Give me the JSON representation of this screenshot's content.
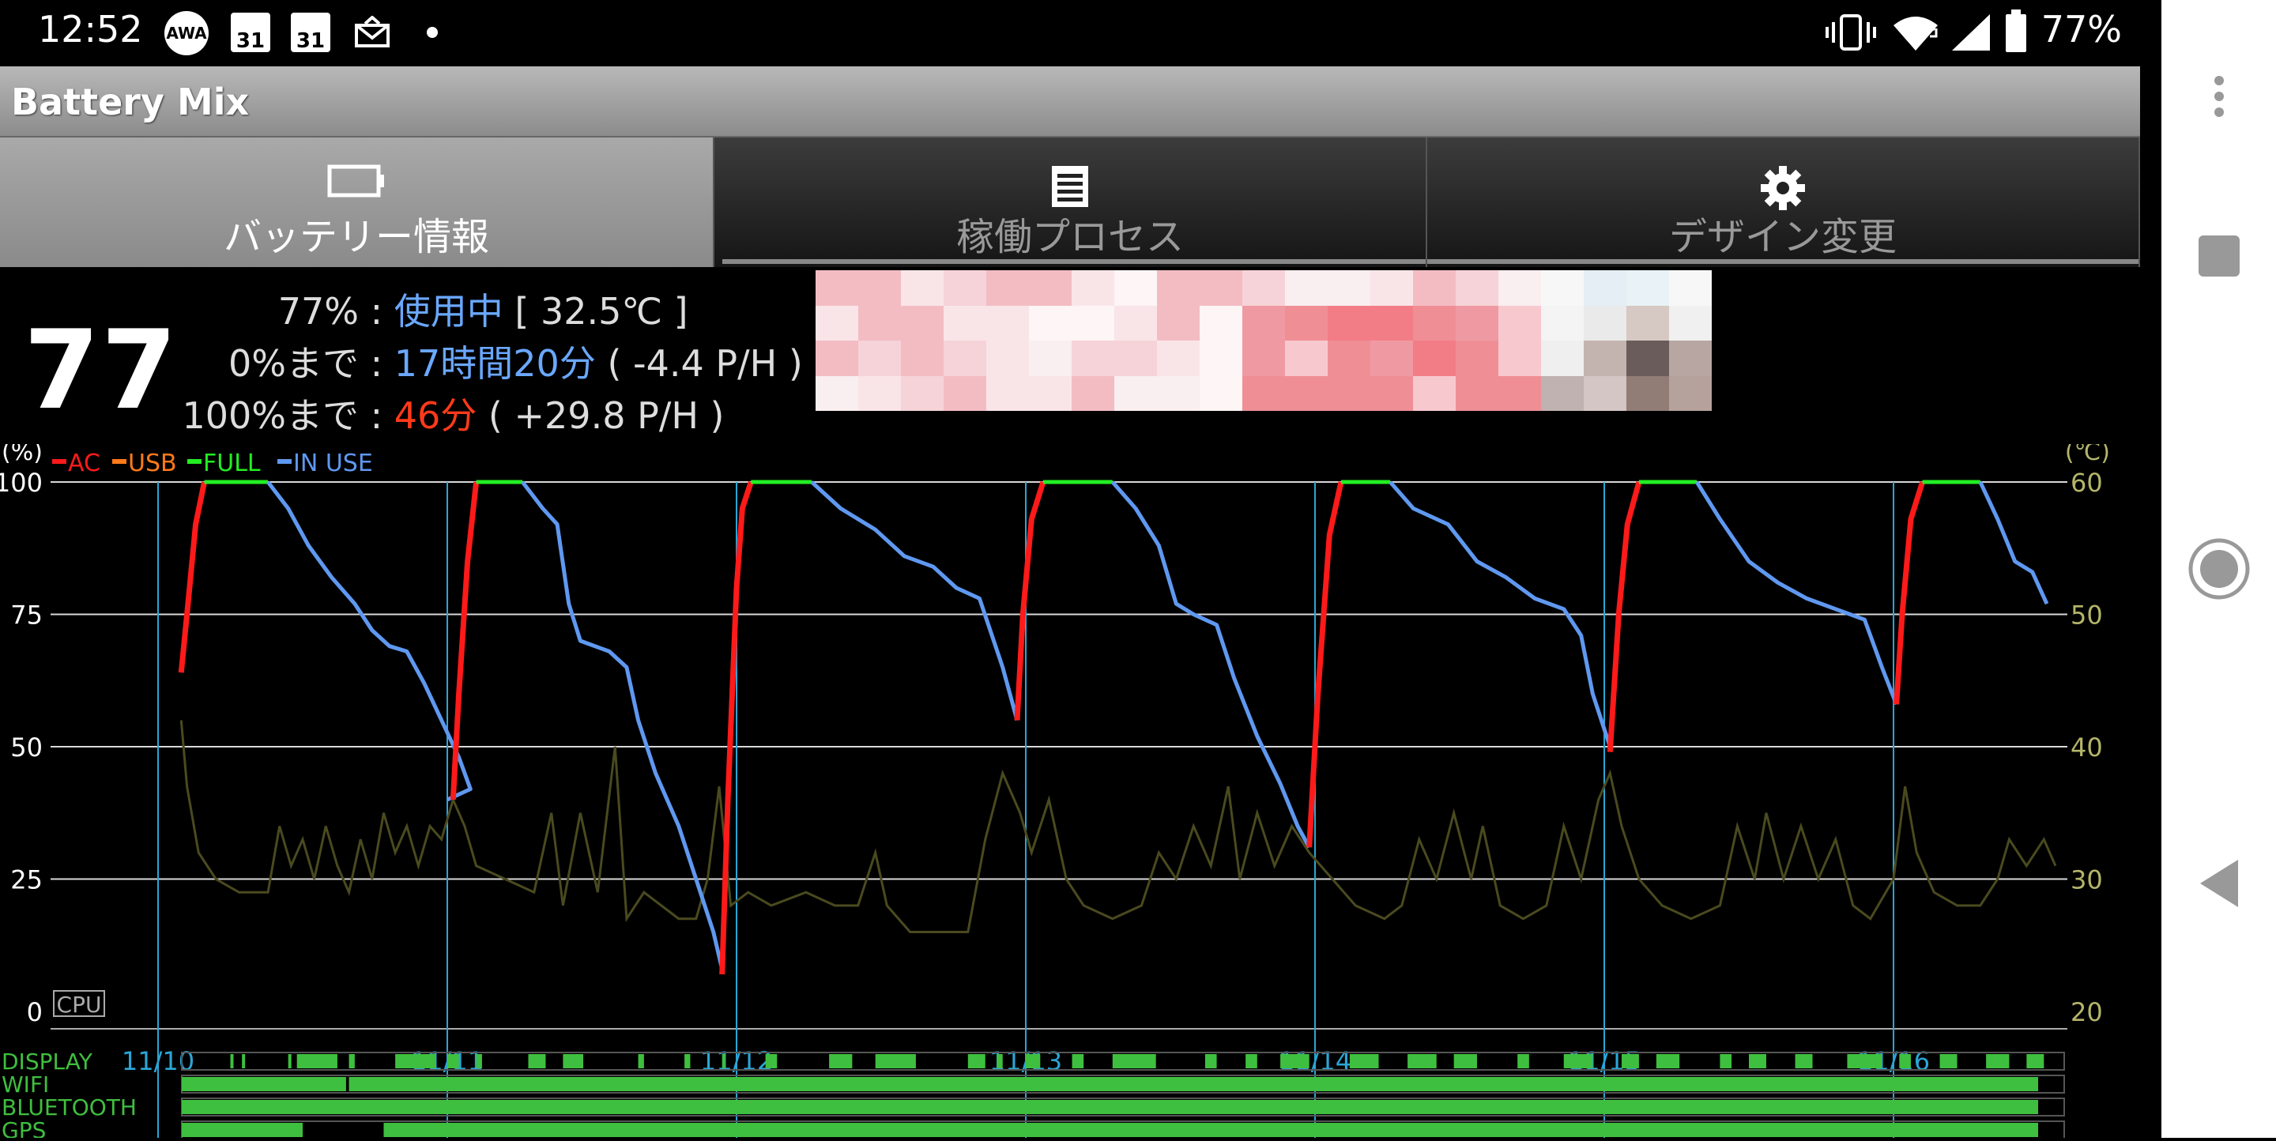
{
  "status_bar": {
    "time": "12:52",
    "icons": [
      "awa-icon",
      "calendar-icon",
      "calendar-icon",
      "mail-icon",
      "dot-icon"
    ],
    "calendar_day": "31",
    "awa_label": "AWA",
    "battery_percent": "77%",
    "right_icons": [
      "vibrate-icon",
      "wifi-icon",
      "signal-icon",
      "battery-icon"
    ]
  },
  "app": {
    "title": "Battery Mix"
  },
  "tabs": [
    {
      "label": "バッテリー情報",
      "icon": "battery-outline-icon",
      "selected": true
    },
    {
      "label": "稼働プロセス",
      "icon": "list-icon",
      "selected": false
    },
    {
      "label": "デザイン変更",
      "icon": "gear-icon",
      "selected": false
    }
  ],
  "battery_info": {
    "level": "77",
    "row1_label": "77%",
    "row1_sep": ":",
    "row1_value": "使用中",
    "row1_extra": "[ 32.5℃ ]",
    "row2_label": "0%まで",
    "row2_sep": ":",
    "row2_value": "17時間20分",
    "row2_extra": "( -4.4 P/H )",
    "row3_label": "100%まで",
    "row3_sep": ":",
    "row3_value": "46分",
    "row3_extra": "( +29.8 P/H )"
  },
  "colors": {
    "ac": "#ff1a1a",
    "usb": "#ff7a1a",
    "full": "#22ee22",
    "in_use": "#5f98f0",
    "temp": "#4a4a1f",
    "day_line": "#2aa6d6",
    "grid": "#d8d8d8",
    "bars": "#3fbf3f"
  },
  "chart_data": {
    "type": "line",
    "left_unit": "(%)",
    "right_unit": "(℃)",
    "legend": [
      {
        "name": "AC",
        "color": "#ff1a1a"
      },
      {
        "name": "USB",
        "color": "#ff7a1a"
      },
      {
        "name": "FULL",
        "color": "#22ee22"
      },
      {
        "name": "IN USE",
        "color": "#5f98f0"
      }
    ],
    "cpu_label": "CPU",
    "yticks_left": [
      "100",
      "75",
      "50",
      "25",
      "0"
    ],
    "yticks_right": [
      "60",
      "50",
      "40",
      "30",
      "20"
    ],
    "ylim_left": [
      0,
      100
    ],
    "ylim_right": [
      20,
      60
    ],
    "x_labels": [
      "11/10",
      "11/11",
      "11/12",
      "11/13",
      "11/14",
      "11/15",
      "11/16"
    ],
    "x_range_days": [
      0,
      6.6
    ],
    "battery_series": [
      [
        0.08,
        64,
        "ac"
      ],
      [
        0.1,
        75,
        "ac"
      ],
      [
        0.13,
        92,
        "ac"
      ],
      [
        0.16,
        100,
        "ac"
      ],
      [
        0.16,
        100,
        "full"
      ],
      [
        0.38,
        100,
        "full"
      ],
      [
        0.38,
        100,
        "use"
      ],
      [
        0.45,
        95,
        "use"
      ],
      [
        0.52,
        88,
        "use"
      ],
      [
        0.6,
        82,
        "use"
      ],
      [
        0.68,
        77,
        "use"
      ],
      [
        0.74,
        72,
        "use"
      ],
      [
        0.8,
        69,
        "use"
      ],
      [
        0.86,
        68,
        "use"
      ],
      [
        0.92,
        62,
        "use"
      ],
      [
        0.98,
        55,
        "use"
      ],
      [
        1.04,
        48,
        "use"
      ],
      [
        1.08,
        42,
        "use"
      ],
      [
        1.0,
        40,
        "use"
      ],
      [
        1.02,
        40,
        "ac"
      ],
      [
        1.04,
        60,
        "ac"
      ],
      [
        1.07,
        85,
        "ac"
      ],
      [
        1.1,
        100,
        "ac"
      ],
      [
        1.1,
        100,
        "full"
      ],
      [
        1.26,
        100,
        "full"
      ],
      [
        1.26,
        100,
        "use"
      ],
      [
        1.33,
        95,
        "use"
      ],
      [
        1.38,
        92,
        "use"
      ],
      [
        1.42,
        77,
        "use"
      ],
      [
        1.46,
        70,
        "use"
      ],
      [
        1.56,
        68,
        "use"
      ],
      [
        1.62,
        65,
        "use"
      ],
      [
        1.66,
        55,
        "use"
      ],
      [
        1.72,
        45,
        "use"
      ],
      [
        1.8,
        35,
        "use"
      ],
      [
        1.86,
        25,
        "use"
      ],
      [
        1.92,
        15,
        "use"
      ],
      [
        1.95,
        8,
        "use"
      ],
      [
        1.95,
        7,
        "ac"
      ],
      [
        1.97,
        40,
        "ac"
      ],
      [
        2.0,
        80,
        "ac"
      ],
      [
        2.02,
        95,
        "ac"
      ],
      [
        2.05,
        100,
        "ac"
      ],
      [
        2.05,
        100,
        "full"
      ],
      [
        2.26,
        100,
        "full"
      ],
      [
        2.26,
        100,
        "use"
      ],
      [
        2.36,
        95,
        "use"
      ],
      [
        2.48,
        91,
        "use"
      ],
      [
        2.58,
        86,
        "use"
      ],
      [
        2.68,
        84,
        "use"
      ],
      [
        2.76,
        80,
        "use"
      ],
      [
        2.84,
        78,
        "use"
      ],
      [
        2.92,
        65,
        "use"
      ],
      [
        2.97,
        55,
        "use"
      ],
      [
        2.97,
        55,
        "ac"
      ],
      [
        2.99,
        75,
        "ac"
      ],
      [
        3.02,
        93,
        "ac"
      ],
      [
        3.06,
        100,
        "ac"
      ],
      [
        3.06,
        100,
        "full"
      ],
      [
        3.3,
        100,
        "full"
      ],
      [
        3.3,
        100,
        "use"
      ],
      [
        3.38,
        95,
        "use"
      ],
      [
        3.46,
        88,
        "use"
      ],
      [
        3.52,
        77,
        "use"
      ],
      [
        3.58,
        75,
        "use"
      ],
      [
        3.66,
        73,
        "use"
      ],
      [
        3.72,
        63,
        "use"
      ],
      [
        3.8,
        52,
        "use"
      ],
      [
        3.88,
        43,
        "use"
      ],
      [
        3.94,
        35,
        "use"
      ],
      [
        3.98,
        31,
        "use"
      ],
      [
        3.98,
        31,
        "ac"
      ],
      [
        4.01,
        60,
        "ac"
      ],
      [
        4.05,
        90,
        "ac"
      ],
      [
        4.09,
        100,
        "ac"
      ],
      [
        4.09,
        100,
        "full"
      ],
      [
        4.26,
        100,
        "full"
      ],
      [
        4.26,
        100,
        "use"
      ],
      [
        4.34,
        95,
        "use"
      ],
      [
        4.46,
        92,
        "use"
      ],
      [
        4.56,
        85,
        "use"
      ],
      [
        4.66,
        82,
        "use"
      ],
      [
        4.76,
        78,
        "use"
      ],
      [
        4.86,
        76,
        "use"
      ],
      [
        4.92,
        71,
        "use"
      ],
      [
        4.96,
        60,
        "use"
      ],
      [
        5.02,
        50,
        "use"
      ],
      [
        5.02,
        49,
        "ac"
      ],
      [
        5.05,
        75,
        "ac"
      ],
      [
        5.08,
        92,
        "ac"
      ],
      [
        5.12,
        100,
        "ac"
      ],
      [
        5.12,
        100,
        "full"
      ],
      [
        5.32,
        100,
        "full"
      ],
      [
        5.32,
        100,
        "use"
      ],
      [
        5.4,
        93,
        "use"
      ],
      [
        5.5,
        85,
        "use"
      ],
      [
        5.6,
        81,
        "use"
      ],
      [
        5.7,
        78,
        "use"
      ],
      [
        5.8,
        76,
        "use"
      ],
      [
        5.9,
        74,
        "use"
      ],
      [
        5.96,
        65,
        "use"
      ],
      [
        6.01,
        58,
        "use"
      ],
      [
        6.01,
        58,
        "ac"
      ],
      [
        6.03,
        75,
        "ac"
      ],
      [
        6.06,
        93,
        "ac"
      ],
      [
        6.1,
        100,
        "ac"
      ],
      [
        6.1,
        100,
        "full"
      ],
      [
        6.3,
        100,
        "full"
      ],
      [
        6.3,
        100,
        "use"
      ],
      [
        6.36,
        93,
        "use"
      ],
      [
        6.42,
        85,
        "use"
      ],
      [
        6.48,
        83,
        "use"
      ],
      [
        6.53,
        77,
        "use"
      ]
    ],
    "temperature_series_c": [
      [
        0.08,
        42
      ],
      [
        0.1,
        37
      ],
      [
        0.14,
        32
      ],
      [
        0.2,
        30
      ],
      [
        0.28,
        29
      ],
      [
        0.38,
        29
      ],
      [
        0.42,
        34
      ],
      [
        0.46,
        31
      ],
      [
        0.5,
        33
      ],
      [
        0.54,
        30
      ],
      [
        0.58,
        34
      ],
      [
        0.62,
        31
      ],
      [
        0.66,
        29
      ],
      [
        0.7,
        33
      ],
      [
        0.74,
        30
      ],
      [
        0.78,
        35
      ],
      [
        0.82,
        32
      ],
      [
        0.86,
        34
      ],
      [
        0.9,
        31
      ],
      [
        0.94,
        34
      ],
      [
        0.98,
        33
      ],
      [
        1.02,
        36
      ],
      [
        1.06,
        34
      ],
      [
        1.1,
        31
      ],
      [
        1.2,
        30
      ],
      [
        1.3,
        29
      ],
      [
        1.36,
        35
      ],
      [
        1.4,
        28
      ],
      [
        1.46,
        35
      ],
      [
        1.52,
        29
      ],
      [
        1.58,
        40
      ],
      [
        1.62,
        27
      ],
      [
        1.68,
        29
      ],
      [
        1.74,
        28
      ],
      [
        1.8,
        27
      ],
      [
        1.86,
        27
      ],
      [
        1.9,
        30
      ],
      [
        1.94,
        37
      ],
      [
        1.98,
        28
      ],
      [
        2.04,
        29
      ],
      [
        2.12,
        28
      ],
      [
        2.24,
        29
      ],
      [
        2.34,
        28
      ],
      [
        2.42,
        28
      ],
      [
        2.48,
        32
      ],
      [
        2.52,
        28
      ],
      [
        2.6,
        26
      ],
      [
        2.7,
        26
      ],
      [
        2.8,
        26
      ],
      [
        2.86,
        33
      ],
      [
        2.92,
        38
      ],
      [
        2.98,
        35
      ],
      [
        3.02,
        32
      ],
      [
        3.08,
        36
      ],
      [
        3.14,
        30
      ],
      [
        3.2,
        28
      ],
      [
        3.3,
        27
      ],
      [
        3.4,
        28
      ],
      [
        3.46,
        32
      ],
      [
        3.52,
        30
      ],
      [
        3.58,
        34
      ],
      [
        3.64,
        31
      ],
      [
        3.7,
        37
      ],
      [
        3.74,
        30
      ],
      [
        3.8,
        35
      ],
      [
        3.86,
        31
      ],
      [
        3.92,
        34
      ],
      [
        3.98,
        32
      ],
      [
        4.06,
        30
      ],
      [
        4.14,
        28
      ],
      [
        4.24,
        27
      ],
      [
        4.3,
        28
      ],
      [
        4.36,
        33
      ],
      [
        4.42,
        30
      ],
      [
        4.48,
        35
      ],
      [
        4.54,
        30
      ],
      [
        4.58,
        34
      ],
      [
        4.64,
        28
      ],
      [
        4.72,
        27
      ],
      [
        4.8,
        28
      ],
      [
        4.86,
        34
      ],
      [
        4.92,
        30
      ],
      [
        4.98,
        36
      ],
      [
        5.02,
        38
      ],
      [
        5.06,
        34
      ],
      [
        5.12,
        30
      ],
      [
        5.2,
        28
      ],
      [
        5.3,
        27
      ],
      [
        5.4,
        28
      ],
      [
        5.46,
        34
      ],
      [
        5.52,
        30
      ],
      [
        5.56,
        35
      ],
      [
        5.62,
        30
      ],
      [
        5.68,
        34
      ],
      [
        5.74,
        30
      ],
      [
        5.8,
        33
      ],
      [
        5.86,
        28
      ],
      [
        5.92,
        27
      ],
      [
        6.0,
        30
      ],
      [
        6.04,
        37
      ],
      [
        6.08,
        32
      ],
      [
        6.14,
        29
      ],
      [
        6.22,
        28
      ],
      [
        6.3,
        28
      ],
      [
        6.36,
        30
      ],
      [
        6.4,
        33
      ],
      [
        6.46,
        31
      ],
      [
        6.52,
        33
      ],
      [
        6.56,
        31
      ]
    ]
  },
  "activity_bars": [
    {
      "label": "DISPLAY",
      "segments": [
        [
          0.0,
          0.05
        ],
        [
          0.25,
          0.26
        ],
        [
          0.29,
          0.29
        ],
        [
          0.45,
          0.46
        ],
        [
          0.48,
          0.62
        ],
        [
          0.66,
          0.68
        ],
        [
          0.82,
          0.96
        ],
        [
          1.0,
          1.04
        ],
        [
          1.1,
          1.12
        ],
        [
          1.28,
          1.34
        ],
        [
          1.4,
          1.47
        ],
        [
          1.66,
          1.68
        ],
        [
          1.82,
          1.84
        ],
        [
          1.95,
          1.96
        ],
        [
          2.1,
          2.14
        ],
        [
          2.32,
          2.4
        ],
        [
          2.48,
          2.62
        ],
        [
          2.8,
          2.86
        ],
        [
          2.9,
          2.92
        ],
        [
          3.0,
          3.05
        ],
        [
          3.16,
          3.2
        ],
        [
          3.3,
          3.45
        ],
        [
          3.62,
          3.66
        ],
        [
          3.76,
          3.8
        ],
        [
          3.88,
          3.98
        ],
        [
          4.12,
          4.22
        ],
        [
          4.32,
          4.42
        ],
        [
          4.48,
          4.56
        ],
        [
          4.7,
          4.74
        ],
        [
          4.86,
          4.96
        ],
        [
          5.06,
          5.12
        ],
        [
          5.18,
          5.26
        ],
        [
          5.4,
          5.44
        ],
        [
          5.5,
          5.56
        ],
        [
          5.66,
          5.72
        ],
        [
          5.84,
          5.96
        ],
        [
          6.02,
          6.06
        ],
        [
          6.16,
          6.22
        ],
        [
          6.32,
          6.4
        ],
        [
          6.46,
          6.52
        ]
      ]
    },
    {
      "label": "WIFI",
      "segments": [
        [
          0.08,
          0.65
        ],
        [
          0.66,
          6.5
        ]
      ]
    },
    {
      "label": "BLUETOOTH",
      "segments": [
        [
          0.08,
          6.5
        ]
      ]
    },
    {
      "label": "GPS",
      "segments": [
        [
          0.08,
          0.5
        ],
        [
          0.78,
          6.5
        ]
      ]
    }
  ],
  "nav_bar": {
    "icons": [
      "more-vert-icon",
      "square-icon",
      "circle-icon",
      "back-triangle-icon"
    ]
  }
}
